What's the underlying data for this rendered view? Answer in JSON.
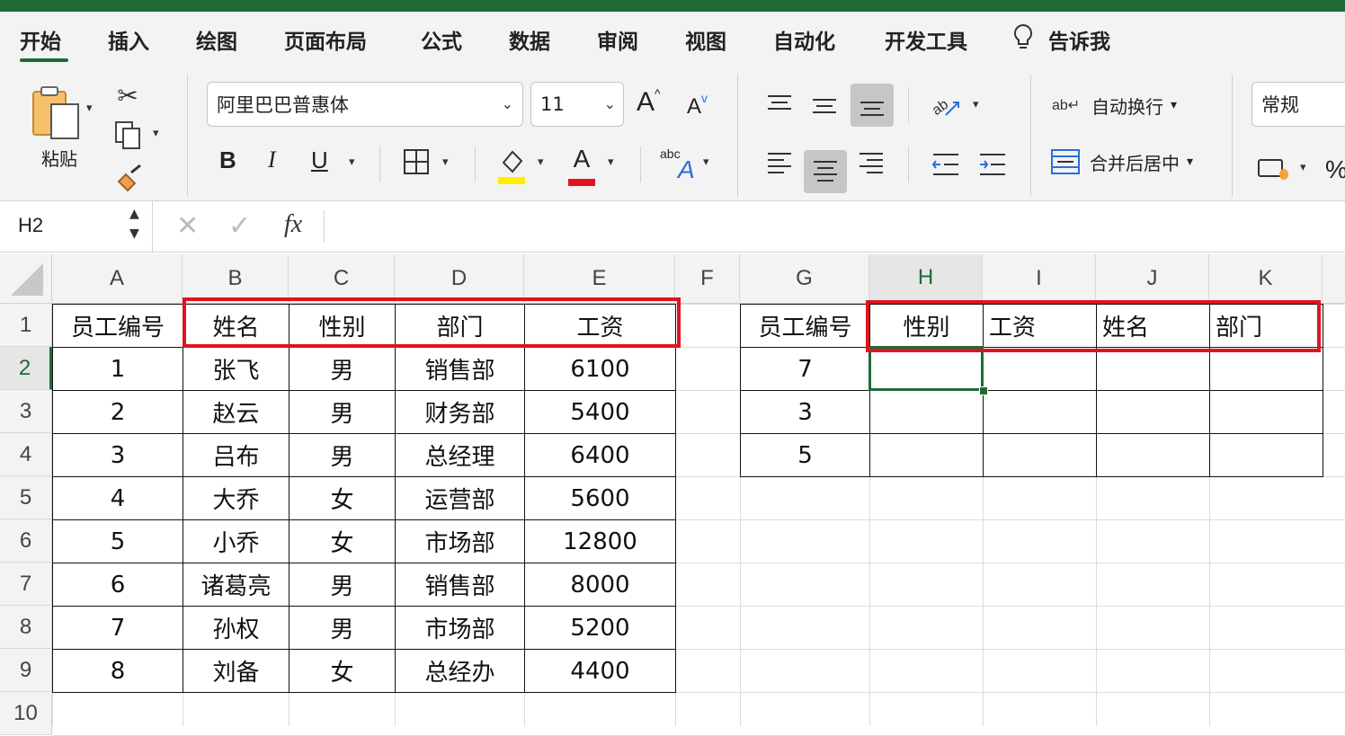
{
  "ribbon": {
    "tabs": [
      "开始",
      "插入",
      "绘图",
      "页面布局",
      "公式",
      "数据",
      "审阅",
      "视图",
      "自动化",
      "开发工具"
    ],
    "tell_me": "告诉我",
    "paste_label": "粘贴",
    "font_name": "阿里巴巴普惠体",
    "font_size": "11",
    "wrap_text_label": "自动换行",
    "merge_center_label": "合并后居中",
    "number_format": "常规",
    "bold": "B",
    "italic": "I",
    "underline": "U",
    "increase_font": "A",
    "decrease_font": "A",
    "font_color_letter": "A",
    "abc_label": "abc",
    "colors": {
      "accent": "#1f6b36",
      "highlight": "#ffee00",
      "font_color": "#e0141e"
    }
  },
  "formula_bar": {
    "name_box": "H2",
    "fx": "fx",
    "content": ""
  },
  "sheet": {
    "columns": [
      "A",
      "B",
      "C",
      "D",
      "E",
      "F",
      "G",
      "H",
      "I",
      "J",
      "K"
    ],
    "rows": [
      "1",
      "2",
      "3",
      "4",
      "5",
      "6",
      "7",
      "8",
      "9",
      "10"
    ],
    "selected_cell": "H2",
    "table1": {
      "headers": [
        "员工编号",
        "姓名",
        "性别",
        "部门",
        "工资"
      ],
      "rows": [
        [
          "1",
          "张飞",
          "男",
          "销售部",
          "6100"
        ],
        [
          "2",
          "赵云",
          "男",
          "财务部",
          "5400"
        ],
        [
          "3",
          "吕布",
          "男",
          "总经理",
          "6400"
        ],
        [
          "4",
          "大乔",
          "女",
          "运营部",
          "5600"
        ],
        [
          "5",
          "小乔",
          "女",
          "市场部",
          "12800"
        ],
        [
          "6",
          "诸葛亮",
          "男",
          "销售部",
          "8000"
        ],
        [
          "7",
          "孙权",
          "男",
          "市场部",
          "5200"
        ],
        [
          "8",
          "刘备",
          "女",
          "总经办",
          "4400"
        ]
      ]
    },
    "table2": {
      "headers": [
        "员工编号",
        "性别",
        "工资",
        "姓名",
        "部门"
      ],
      "rows": [
        [
          "7",
          "",
          "",
          "",
          ""
        ],
        [
          "3",
          "",
          "",
          "",
          ""
        ],
        [
          "5",
          "",
          "",
          "",
          ""
        ]
      ]
    },
    "highlight_color": "#e0141e"
  }
}
